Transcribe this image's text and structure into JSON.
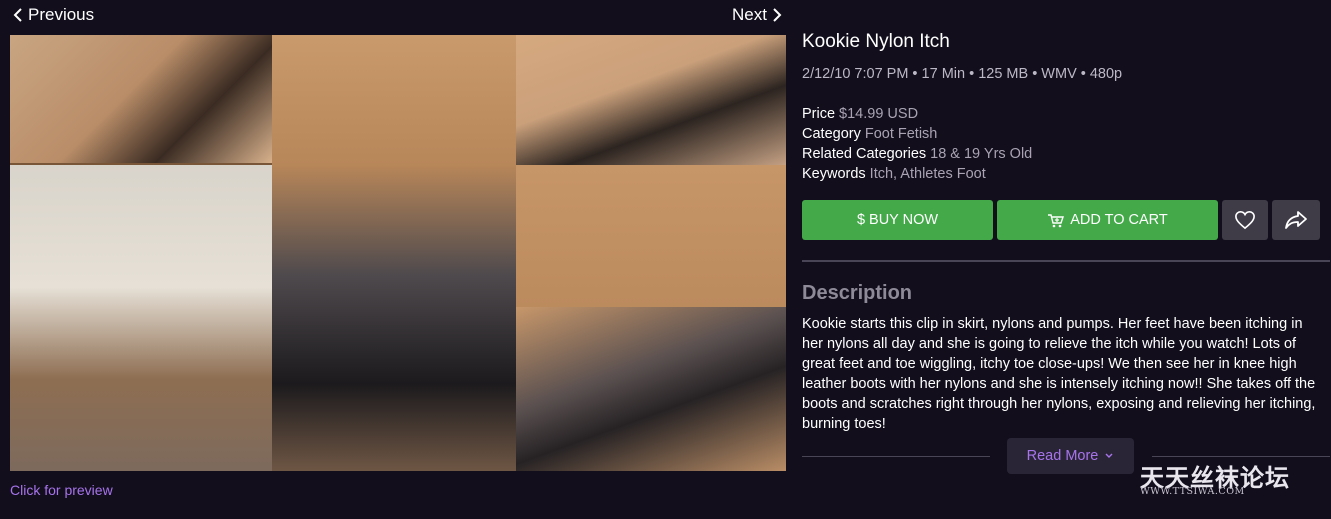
{
  "nav": {
    "previous_label": "Previous",
    "next_label": "Next"
  },
  "preview": {
    "caption": "Click for preview"
  },
  "product": {
    "title": "Kookie Nylon Itch",
    "meta": "2/12/10 7:07 PM • 17 Min • 125 MB • WMV • 480p",
    "details": [
      {
        "label": "Price",
        "value": "$14.99 USD"
      },
      {
        "label": "Category",
        "value": "Foot Fetish"
      },
      {
        "label": "Related Categories",
        "value": "18 & 19 Yrs Old"
      },
      {
        "label": "Keywords",
        "value": "Itch, Athletes Foot"
      }
    ]
  },
  "actions": {
    "buy_label": "$ BUY NOW",
    "cart_label": "ADD TO CART",
    "favorite_icon": "heart-icon",
    "share_icon": "share-icon"
  },
  "description": {
    "heading": "Description",
    "body": "Kookie starts this clip in skirt, nylons and pumps. Her feet have been itching in her nylons all day and she is going to relieve the itch while you watch! Lots of great feet and toe wiggling, itchy toe close-ups! We then see her in knee high leather boots with her nylons and she is intensely itching now!! She takes off the boots and scratches right through her nylons, exposing and relieving her itching, burning toes!",
    "read_more_label": "Read More"
  },
  "watermark": {
    "cn_text": "天天丝袜论坛",
    "en_text": "WWW.TTSIWA.COM"
  },
  "colors": {
    "accent": "#a774ec",
    "buy_green": "#43a949",
    "background": "#120e1c"
  }
}
